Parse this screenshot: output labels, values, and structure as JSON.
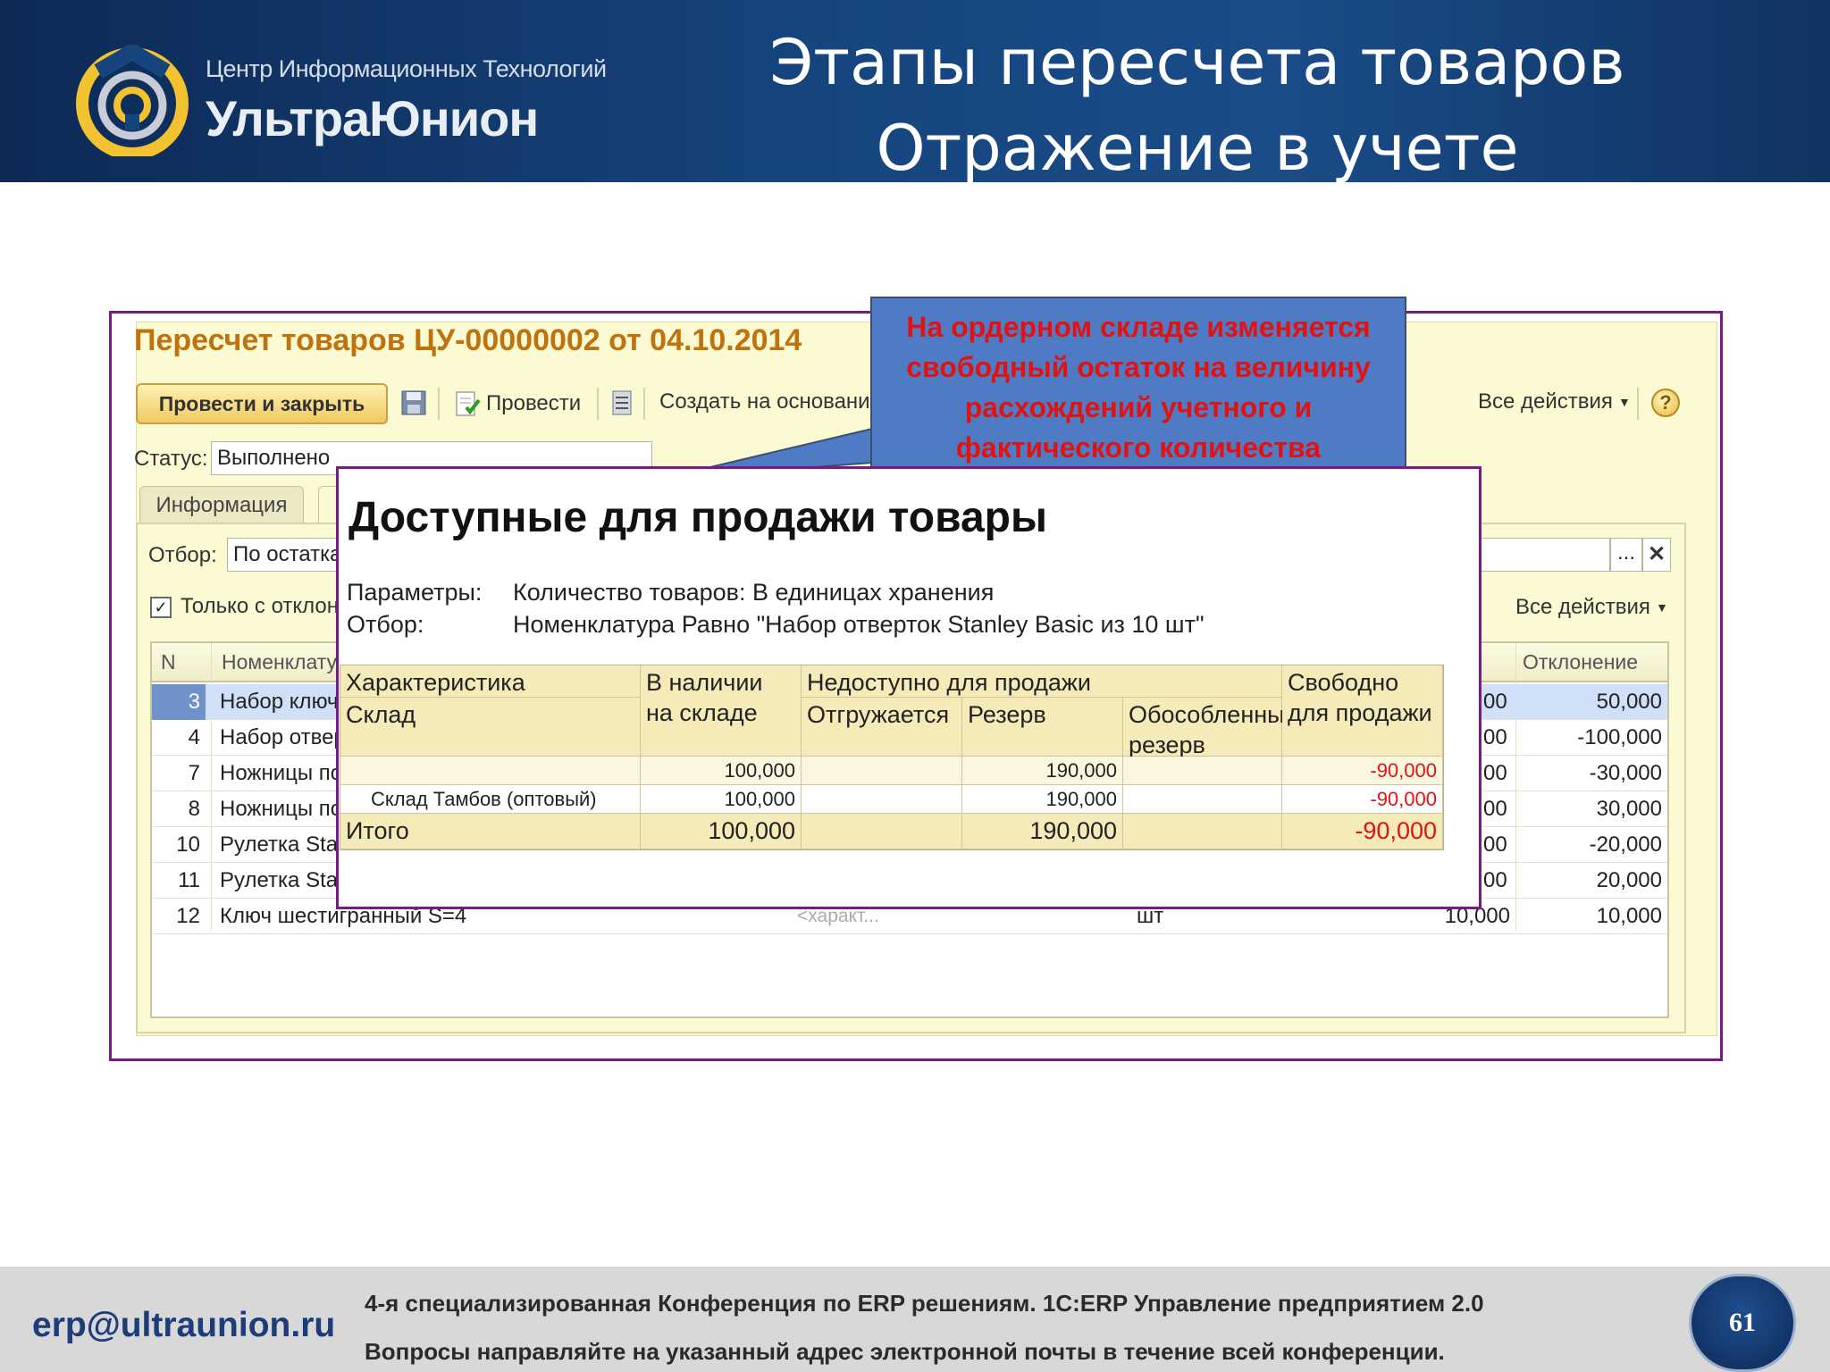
{
  "header": {
    "brand_line1": "Центр Информационных Технологий",
    "brand_line2": "УльтраЮнион",
    "title_line1": "Этапы пересчета товаров",
    "title_line2": "Отражение в учете"
  },
  "doc": {
    "title": "Пересчет товаров ЦУ-00000002 от 04.10.2014",
    "btn_post_close": "Провести и закрыть",
    "btn_post": "Провести",
    "btn_create": "Создать на основании",
    "btn_all_actions": "Все действия",
    "status_label": "Статус:",
    "status_value": "Выполнено",
    "tab_info": "Информация",
    "filter_label": "Отбор:",
    "filter_value": "По остатка",
    "only_dev_label": "Только с отклон",
    "all_actions2": "Все действия",
    "col_n": "N",
    "col_nom": "Номенклату",
    "col_dev": "Отклонение",
    "rows": [
      {
        "n": "3",
        "name": "Набор ключ",
        "q": "00",
        "dev": "50,000"
      },
      {
        "n": "4",
        "name": "Набор отвер",
        "q": "00",
        "dev": "-100,000"
      },
      {
        "n": "7",
        "name": "Ножницы по",
        "q": "00",
        "dev": "-30,000"
      },
      {
        "n": "8",
        "name": "Ножницы по",
        "q": "00",
        "dev": "30,000"
      },
      {
        "n": "10",
        "name": "Рулетка Sta",
        "q": "00",
        "dev": "-20,000"
      },
      {
        "n": "11",
        "name": "Рулетка Sta",
        "q": "00",
        "dev": "20,000"
      },
      {
        "n": "12",
        "name": "Ключ шестигранный S=4",
        "char": "<характ...",
        "unit": "шт",
        "q": "10,000",
        "dev": "10,000"
      }
    ]
  },
  "callout": {
    "text": "На ордерном складе изменяется свободный остаток на величину расхождений учетного и фактического количества"
  },
  "report": {
    "title": "Доступные для продажи товары",
    "params_label": "Параметры:",
    "params_value": "Количество товаров: В единицах хранения",
    "filter_label": "Отбор:",
    "filter_value": "Номенклатура Равно \"Набор отверток Stanley Basic из 10 шт\"",
    "h_char": "Характеристика",
    "h_wh": "Склад",
    "h_avail": "В наличии на складе",
    "h_unavail": "Недоступно для продажи",
    "h_ship": "Отгружается",
    "h_reserve": "Резерв",
    "h_sep_reserve": "Обособленный резерв",
    "h_free": "Свободно для продажи",
    "row1": {
      "avail": "100,000",
      "reserve": "190,000",
      "free": "-90,000"
    },
    "row2": {
      "wh": "Склад Тамбов (оптовый)",
      "avail": "100,000",
      "reserve": "190,000",
      "free": "-90,000"
    },
    "total": {
      "label": "Итого",
      "avail": "100,000",
      "reserve": "190,000",
      "free": "-90,000"
    }
  },
  "footer": {
    "email": "erp@ultraunion.ru",
    "line1": "4-я специализированная Конференция  по ERP решениям. 1С:ERP Управление предприятием 2.0",
    "line2": "Вопросы направляйте на указанный адрес электронной почты в течение всей конференции.",
    "page": "61"
  },
  "colors": {
    "header_bg": "#16457e",
    "frame": "#7a1a86",
    "accent_red": "#e01313",
    "callout_bg": "#4f7bc5"
  }
}
